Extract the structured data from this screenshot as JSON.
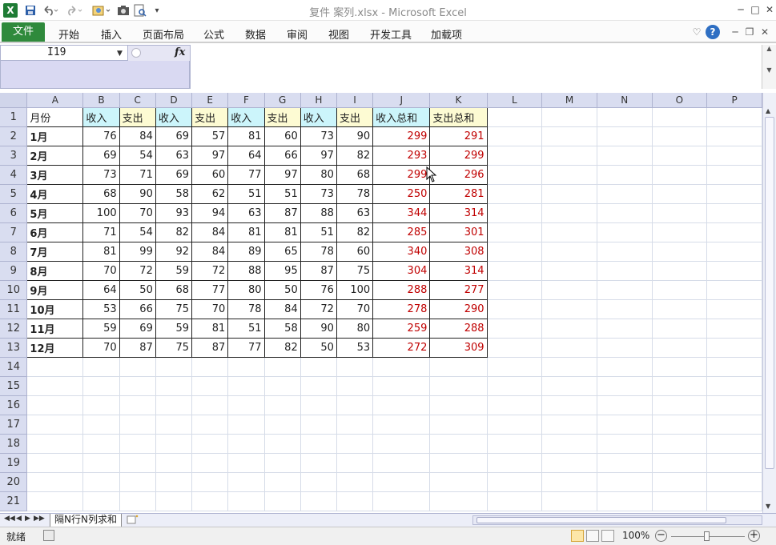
{
  "window": {
    "title": "复件 案列.xlsx  -  Microsoft Excel",
    "app_icon_letter": "X",
    "min": "─",
    "max": "□",
    "close": "✕"
  },
  "ribbon": {
    "file_tab": "文件",
    "tabs": [
      "开始",
      "插入",
      "页面布局",
      "公式",
      "数据",
      "审阅",
      "视图",
      "开发工具",
      "加载项"
    ],
    "help": "?",
    "collapse": "♡"
  },
  "formula_bar": {
    "cell_ref": "I19",
    "fx": "fx",
    "value": ""
  },
  "columns": [
    "A",
    "B",
    "C",
    "D",
    "E",
    "F",
    "G",
    "H",
    "I",
    "J",
    "K",
    "L",
    "M",
    "N",
    "O",
    "P"
  ],
  "header_row": [
    "月份",
    "收入",
    "支出",
    "收入",
    "支出",
    "收入",
    "支出",
    "收入",
    "支出",
    "收入总和",
    "支出总和"
  ],
  "rows": [
    {
      "month": "1月",
      "values": [
        76,
        84,
        69,
        57,
        81,
        60,
        73,
        90
      ],
      "income_sum": 299,
      "expense_sum": 291
    },
    {
      "month": "2月",
      "values": [
        69,
        54,
        63,
        97,
        64,
        66,
        97,
        82
      ],
      "income_sum": 293,
      "expense_sum": 299
    },
    {
      "month": "3月",
      "values": [
        73,
        71,
        69,
        60,
        77,
        97,
        80,
        68
      ],
      "income_sum": 299,
      "expense_sum": 296
    },
    {
      "month": "4月",
      "values": [
        68,
        90,
        58,
        62,
        51,
        51,
        73,
        78
      ],
      "income_sum": 250,
      "expense_sum": 281
    },
    {
      "month": "5月",
      "values": [
        100,
        70,
        93,
        94,
        63,
        87,
        88,
        63
      ],
      "income_sum": 344,
      "expense_sum": 314
    },
    {
      "month": "6月",
      "values": [
        71,
        54,
        82,
        84,
        81,
        81,
        51,
        82
      ],
      "income_sum": 285,
      "expense_sum": 301
    },
    {
      "month": "7月",
      "values": [
        81,
        99,
        92,
        84,
        89,
        65,
        78,
        60
      ],
      "income_sum": 340,
      "expense_sum": 308
    },
    {
      "month": "8月",
      "values": [
        70,
        72,
        59,
        72,
        88,
        95,
        87,
        75
      ],
      "income_sum": 304,
      "expense_sum": 314
    },
    {
      "month": "9月",
      "values": [
        64,
        50,
        68,
        77,
        80,
        50,
        76,
        100
      ],
      "income_sum": 288,
      "expense_sum": 277
    },
    {
      "month": "10月",
      "values": [
        53,
        66,
        75,
        70,
        78,
        84,
        72,
        70
      ],
      "income_sum": 278,
      "expense_sum": 290
    },
    {
      "month": "11月",
      "values": [
        59,
        69,
        59,
        81,
        51,
        58,
        90,
        80
      ],
      "income_sum": 259,
      "expense_sum": 288
    },
    {
      "month": "12月",
      "values": [
        70,
        87,
        75,
        87,
        77,
        82,
        50,
        53
      ],
      "income_sum": 272,
      "expense_sum": 309
    }
  ],
  "row_numbers": [
    1,
    2,
    3,
    4,
    5,
    6,
    7,
    8,
    9,
    10,
    11,
    12,
    13,
    14,
    15,
    16,
    17,
    18,
    19,
    20,
    21
  ],
  "sheet_tabs": {
    "active": "隔N行N列求和",
    "nav": [
      "◀◀",
      "◀",
      "▶",
      "▶▶"
    ]
  },
  "status_bar": {
    "ready": "就绪",
    "zoom": "100%",
    "zoom_out": "−",
    "zoom_in": "+"
  },
  "colors": {
    "income_fill": "#ccf5fb",
    "expense_fill": "#fdfbd3",
    "sum_text": "#c00000",
    "file_tab": "#2f8a3c"
  }
}
